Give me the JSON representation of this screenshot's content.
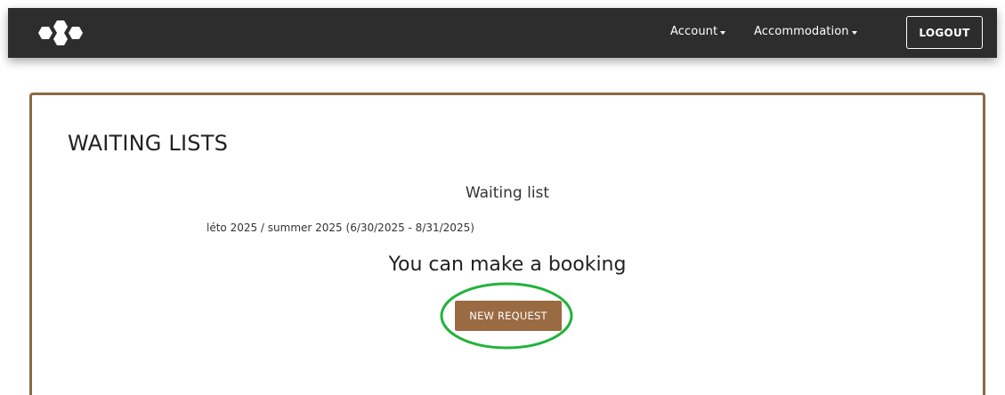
{
  "navbar": {
    "logo_icon": "hexagon-cluster-logo",
    "account_label": "Account",
    "accommodation_label": "Accommodation",
    "logout_label": "LOGOUT",
    "background_color": "#2d2d2d"
  },
  "main": {
    "page_title": "WAITING LISTS",
    "waiting_list_title": "Waiting list",
    "term_text": "léto 2025 / summer 2025 (6/30/2025 - 8/31/2025)",
    "booking_message": "You can make a booking",
    "new_request_label": "NEW REQUEST",
    "accent_color": "#9a6a43",
    "card_border_color": "#8b6a47",
    "highlight_color": "#22b33a"
  }
}
